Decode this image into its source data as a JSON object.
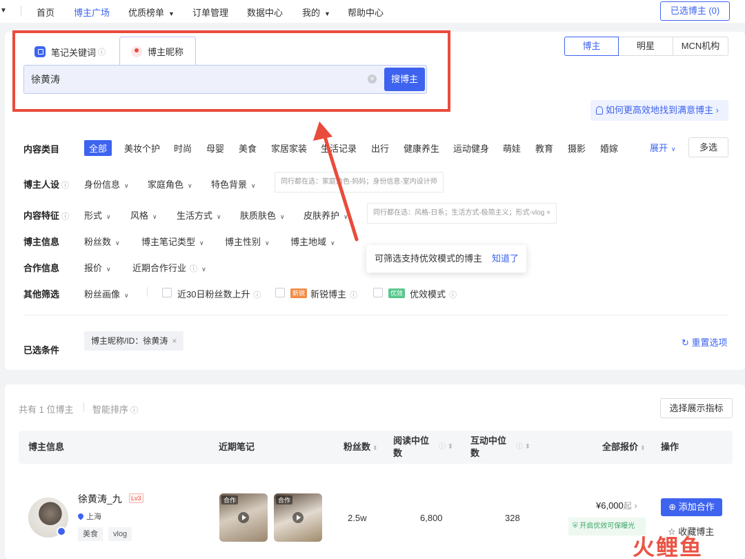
{
  "nav": {
    "items": [
      "首页",
      "博主广场",
      "优质榜单",
      "订单管理",
      "数据中心",
      "我的",
      "帮助中心"
    ],
    "active": "博主广场",
    "selected_btn": "已选博主 (0)"
  },
  "search": {
    "tab_keyword": "笔记关键词",
    "tab_nickname": "博主昵称",
    "value": "徐黄涛",
    "button": "搜博主"
  },
  "type_group": [
    "博主",
    "明星",
    "MCN机构"
  ],
  "howto": "如何更高效地找到满意博主",
  "filters": {
    "content_category": {
      "label": "内容类目",
      "options": [
        "全部",
        "美妆个护",
        "时尚",
        "母婴",
        "美食",
        "家居家装",
        "生活记录",
        "出行",
        "健康养生",
        "运动健身",
        "萌娃",
        "教育",
        "摄影",
        "婚嫁"
      ],
      "expand": "展开",
      "multi": "多选"
    },
    "persona": {
      "label": "博主人设",
      "options": [
        "身份信息",
        "家庭角色",
        "特色背景"
      ],
      "hint": "同行都在选：家庭角色-妈妈；身份信息-室内设计师"
    },
    "content_feature": {
      "label": "内容特征",
      "options": [
        "形式",
        "风格",
        "生活方式",
        "肤质肤色",
        "皮肤养护"
      ],
      "hint": "同行都在选：风格-日系；生活方式-极简主义；形式-vlog ×"
    },
    "blogger_info": {
      "label": "博主信息",
      "options": [
        "粉丝数",
        "博主笔记类型",
        "博主性别",
        "博主地域"
      ]
    },
    "coop_info": {
      "label": "合作信息",
      "options": [
        "报价",
        "近期合作行业"
      ]
    },
    "other": {
      "label": "其他筛选",
      "fans_portrait": "粉丝画像",
      "fans_up": "近30日粉丝数上升",
      "new_badge": "新锐",
      "new_blogger": "新锐博主",
      "effect_badge": "优效",
      "effect_mode": "优效模式"
    }
  },
  "tooltip": {
    "text": "可筛选支持优效模式的博主",
    "link": "知道了"
  },
  "selected": {
    "label": "已选条件",
    "chip": "博主昵称/ID：徐黄涛",
    "reset": "重置选项"
  },
  "results": {
    "count": "共有 1 位博主",
    "sort": "智能排序",
    "metric_btn": "选择展示指标",
    "headers": {
      "info": "博主信息",
      "notes": "近期笔记",
      "fans": "粉丝数",
      "read_l1": "阅读中位",
      "read_l2": "数",
      "inter_l1": "互动中位",
      "inter_l2": "数",
      "price": "全部报价",
      "ops": "操作"
    },
    "row": {
      "name": "徐黄涛_九",
      "level": "Lv3",
      "location": "上海",
      "tags": [
        "美食",
        "vlog"
      ],
      "note_label": "合作",
      "fans": "2.5w",
      "read_median": "6,800",
      "interact_median": "328",
      "price": "¥6,000",
      "price_suffix": "起",
      "promo": "开启优效可保曝光",
      "add": "添加合作",
      "fav": "收藏博主"
    }
  },
  "watermark": "火鲤鱼",
  "colors": {
    "accent": "#3d63ef",
    "annotation_red": "#e94b3c"
  }
}
